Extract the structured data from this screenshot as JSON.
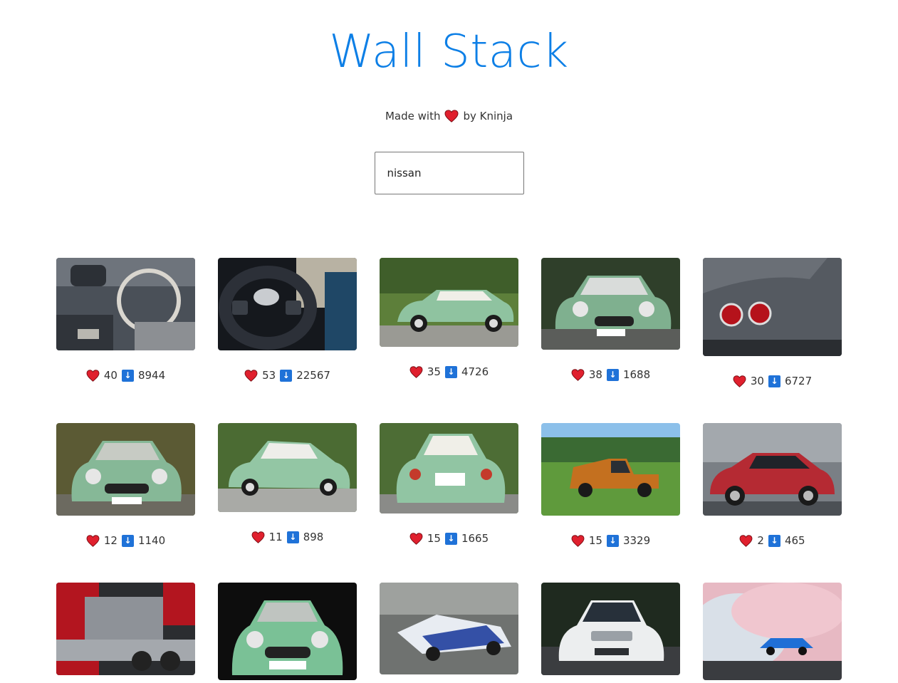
{
  "header": {
    "title": "Wall Stack",
    "made_with": "Made with",
    "by": "by Kninja"
  },
  "search": {
    "value": "nissan"
  },
  "cards": [
    {
      "likes": "40",
      "downloads": "8944",
      "icon": "dashboard-interior"
    },
    {
      "likes": "53",
      "downloads": "22567",
      "icon": "steering-wheel"
    },
    {
      "likes": "35",
      "downloads": "4726",
      "icon": "green-figaro"
    },
    {
      "likes": "38",
      "downloads": "1688",
      "icon": "green-figaro-front"
    },
    {
      "likes": "30",
      "downloads": "6727",
      "icon": "gtr-taillights"
    },
    {
      "likes": "12",
      "downloads": "1140",
      "icon": "green-figaro-front"
    },
    {
      "likes": "11",
      "downloads": "898",
      "icon": "green-figaro-rear"
    },
    {
      "likes": "15",
      "downloads": "1665",
      "icon": "green-figaro-rear"
    },
    {
      "likes": "15",
      "downloads": "3329",
      "icon": "orange-pickup"
    },
    {
      "likes": "2",
      "downloads": "465",
      "icon": "red-juke"
    },
    {
      "likes": "",
      "downloads": "",
      "icon": "engine-bay"
    },
    {
      "likes": "",
      "downloads": "",
      "icon": "green-figaro-front"
    },
    {
      "likes": "",
      "downloads": "",
      "icon": "drift-car"
    },
    {
      "likes": "",
      "downloads": "",
      "icon": "white-altima"
    },
    {
      "likes": "",
      "downloads": "",
      "icon": "burnout-smoke"
    }
  ],
  "colors": {
    "title": "#0d7fe6",
    "heart": "#e0202e",
    "download_badge": "#1f72d8"
  }
}
